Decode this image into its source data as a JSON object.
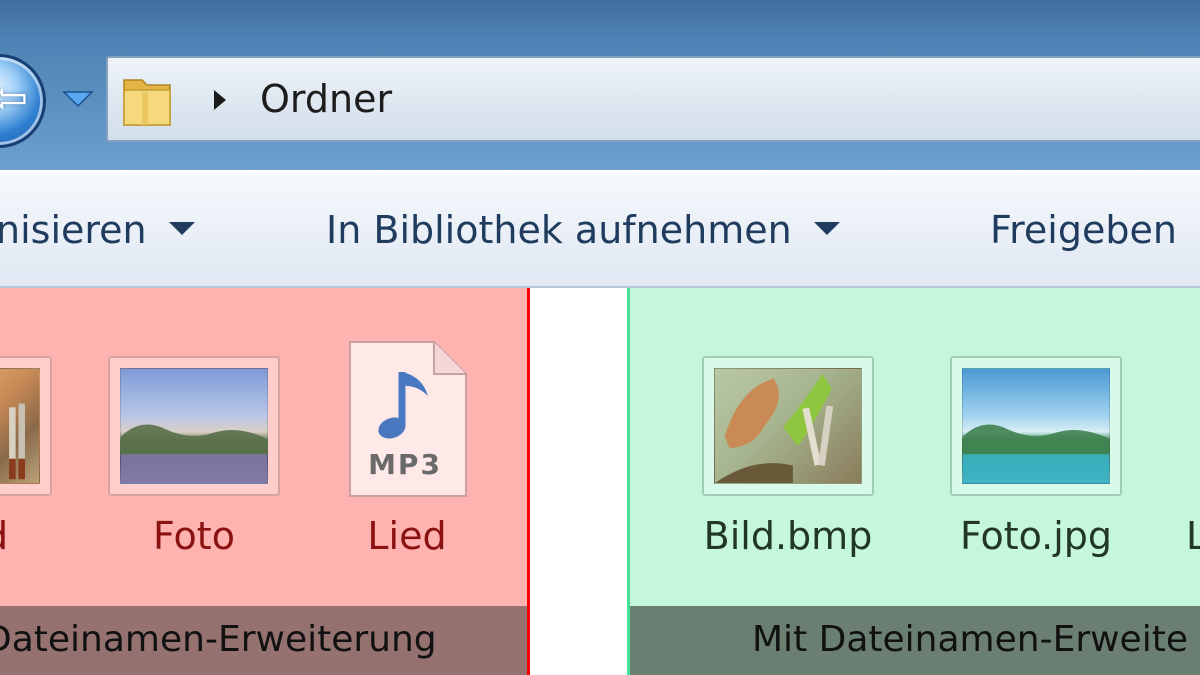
{
  "window": {
    "back_glyph": "⇦",
    "address": {
      "path_segment": "Ordner"
    }
  },
  "toolbar": {
    "organize_label": "nisieren",
    "library_label": "In Bibliothek aufnehmen",
    "share_label": "Freigeben"
  },
  "colors": {
    "titlebar": "#4f83b5",
    "left_panel": "#ffb3b1",
    "left_divider": "#ff0000",
    "right_panel": "#c4f7dc",
    "right_divider": "#47e09a",
    "left_caption": "#957270",
    "right_caption": "#6a7f72"
  },
  "left_panel": {
    "files": [
      {
        "name": "d",
        "icon": "image-icon"
      },
      {
        "name": "Foto",
        "icon": "photo-icon"
      },
      {
        "name": "Lied",
        "icon": "mp3-file-icon",
        "badge": "MP3"
      }
    ],
    "caption": "Dateinamen-Erweiterung"
  },
  "right_panel": {
    "files": [
      {
        "name": "Bild.bmp",
        "icon": "image-icon"
      },
      {
        "name": "Foto.jpg",
        "icon": "photo-icon"
      },
      {
        "name": "L",
        "icon": "mp3-file-icon"
      }
    ],
    "caption": "Mit Dateinamen-Erweite"
  }
}
